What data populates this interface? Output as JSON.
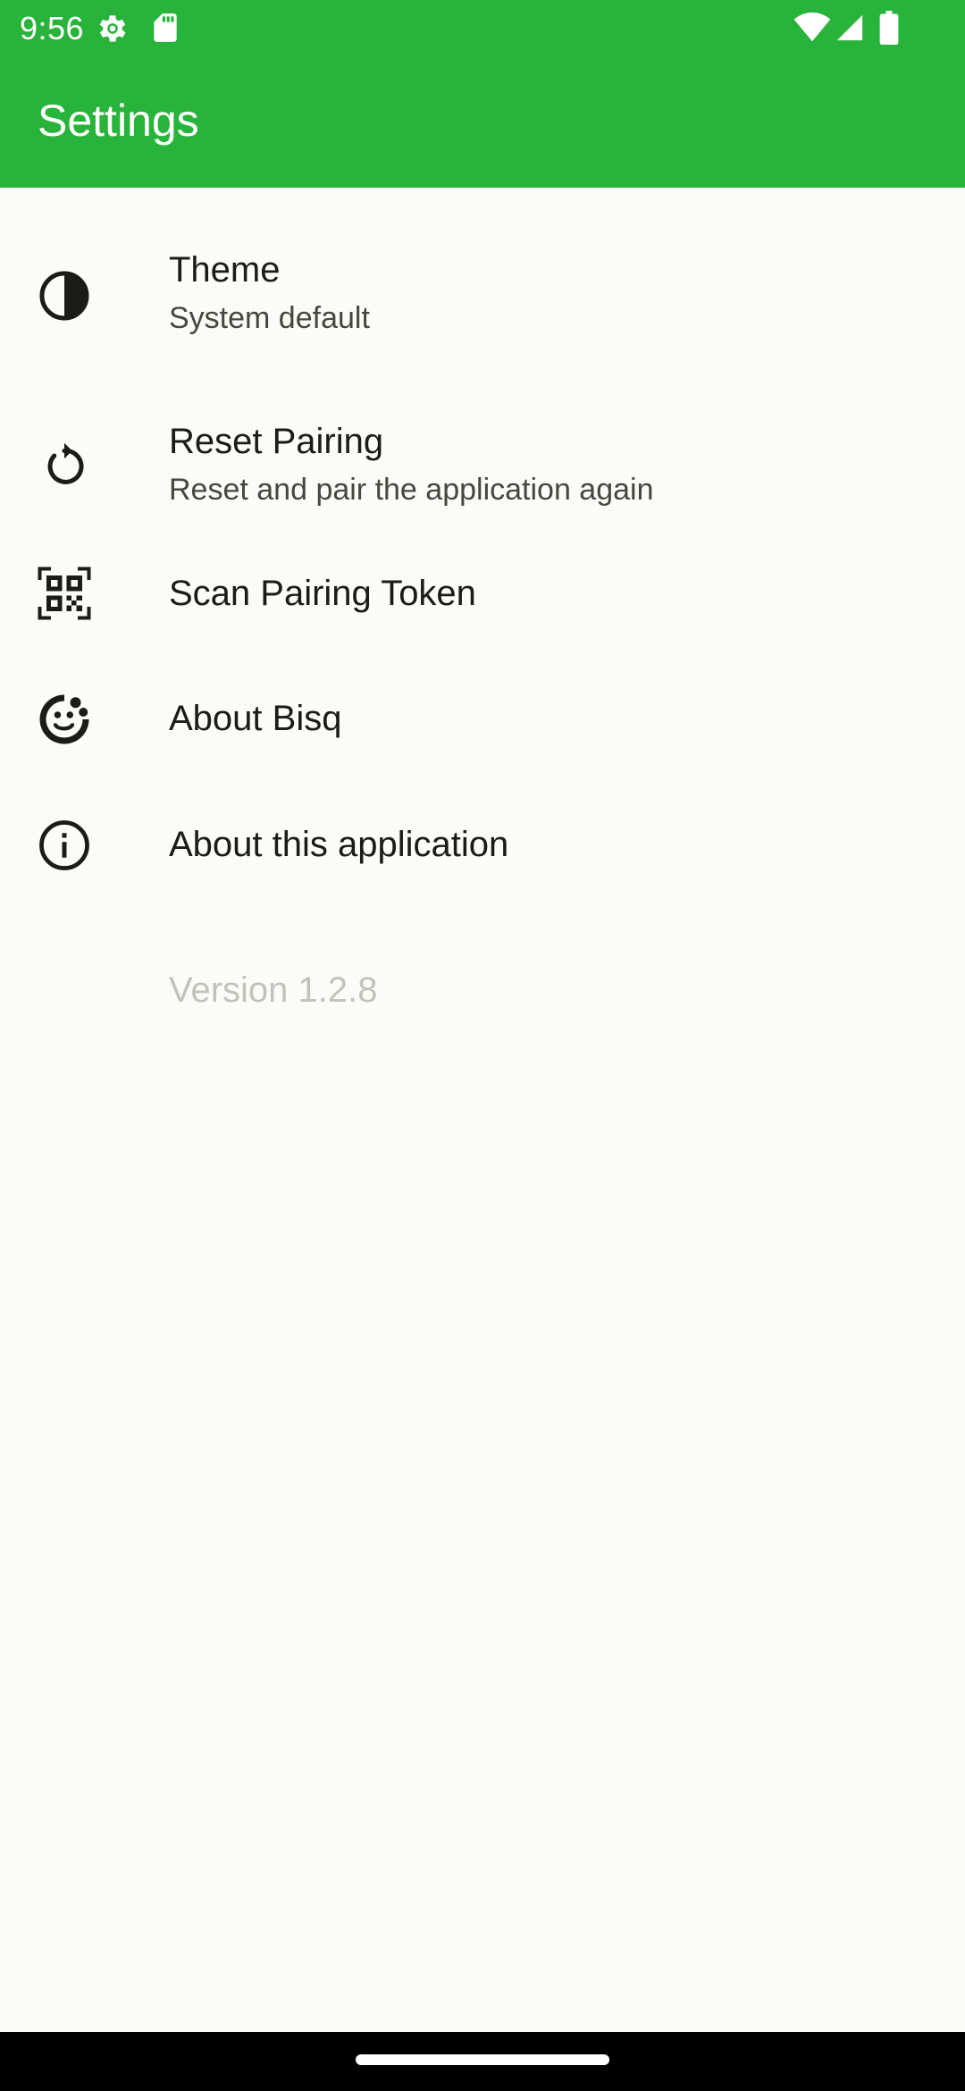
{
  "colors": {
    "header": "#28b33a",
    "background": "#fbfcf7",
    "text_primary": "#1b1c18",
    "text_secondary": "#45483f",
    "text_disabled": "#c1c3bb"
  },
  "status_bar": {
    "time": "9:56",
    "icons": [
      "settings-gear-icon",
      "sd-card-icon",
      "wifi-icon",
      "cellular-signal-icon",
      "battery-icon"
    ]
  },
  "header": {
    "title": "Settings"
  },
  "settings": {
    "items": [
      {
        "icon": "theme-contrast-icon",
        "title": "Theme",
        "subtitle": "System default"
      },
      {
        "icon": "reset-refresh-icon",
        "title": "Reset Pairing",
        "subtitle": "Reset and pair the application again"
      },
      {
        "icon": "qr-code-scan-icon",
        "title": "Scan Pairing Token"
      },
      {
        "icon": "bisq-logo-icon",
        "title": "About Bisq"
      },
      {
        "icon": "info-icon",
        "title": "About this application"
      }
    ],
    "version": "Version 1.2.8"
  }
}
